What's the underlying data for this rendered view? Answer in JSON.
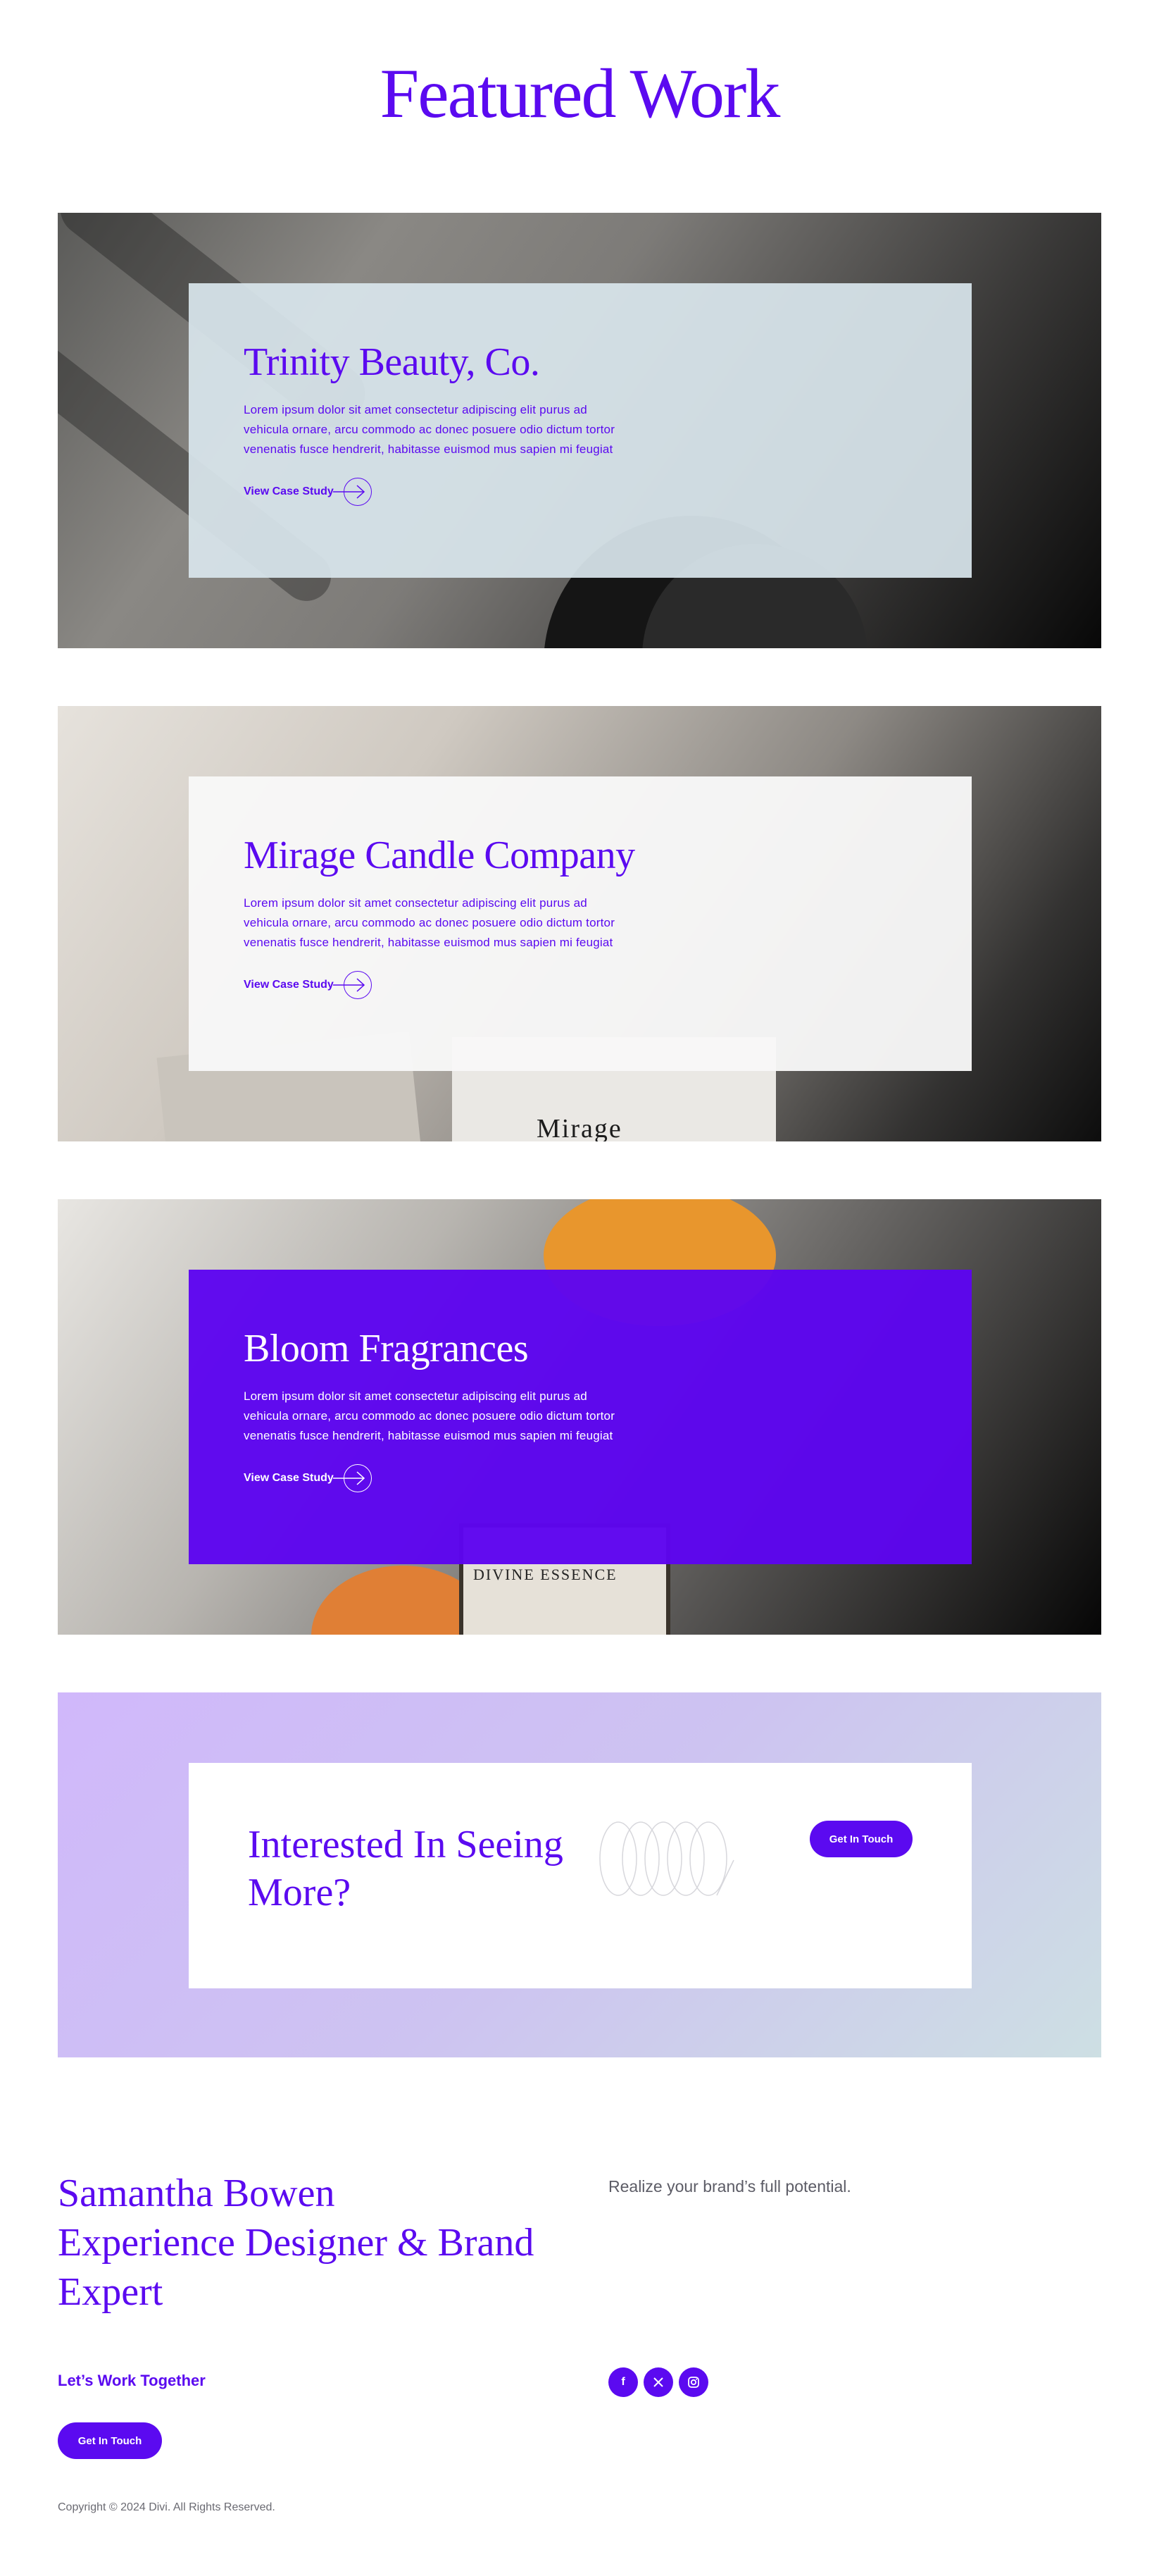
{
  "page": {
    "title": "Featured Work"
  },
  "projects": [
    {
      "title": "Trinity Beauty, Co.",
      "description": "Lorem ipsum dolor sit amet consectetur adipiscing elit purus ad vehicula ornare, arcu commodo ac donec posuere odio dictum tortor venenatis fusce hendrerit, habitasse euismod mus sapien mi feugiat",
      "link_label": "View Case Study"
    },
    {
      "title": "Mirage Candle Company",
      "description": "Lorem ipsum dolor sit amet consectetur adipiscing elit purus ad vehicula ornare, arcu commodo ac donec posuere odio dictum tortor venenatis fusce hendrerit, habitasse euismod mus sapien mi feugiat",
      "link_label": "View Case Study",
      "photo_text": "Mirage"
    },
    {
      "title": "Bloom Fragrances",
      "description": "Lorem ipsum dolor sit amet consectetur adipiscing elit purus ad vehicula ornare, arcu commodo ac donec posuere odio dictum tortor venenatis fusce hendrerit, habitasse euismod mus sapien mi feugiat",
      "link_label": "View Case Study",
      "photo_text": "DIVINE ESSENCE"
    }
  ],
  "cta": {
    "title": "Interested In Seeing More?",
    "button_label": "Get In Touch"
  },
  "footer": {
    "name_lines": [
      "Samantha Bowen",
      "Experience Designer & Brand Expert"
    ],
    "tagline": "Realize your brand’s full potential.",
    "lets_work": "Let’s Work Together",
    "button_label": "Get In Touch",
    "socials": [
      {
        "icon": "facebook-icon",
        "glyph": "f"
      },
      {
        "icon": "x-twitter-icon",
        "glyph": "𝕏"
      },
      {
        "icon": "instagram-icon",
        "glyph": "◎"
      }
    ],
    "copyright": "Copyright © 2024 Divi. All Rights Reserved."
  },
  "colors": {
    "accent": "#5b0af0",
    "card_light": "#d8e5ec",
    "cta_gradient_start": "#d0b8fb",
    "cta_gradient_end": "#cddfe3"
  }
}
